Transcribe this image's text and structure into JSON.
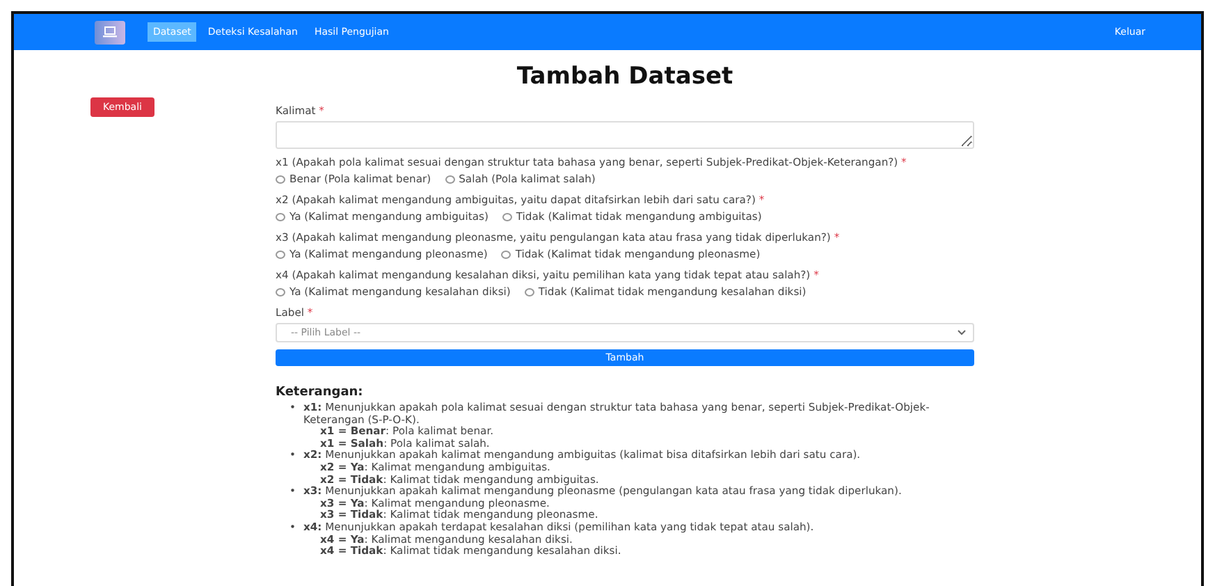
{
  "navbar": {
    "items": [
      {
        "label": "Dataset",
        "selected": true
      },
      {
        "label": "Deteksi Kesalahan",
        "selected": false
      },
      {
        "label": "Hasil Pengujian",
        "selected": false
      }
    ],
    "logout": "Keluar"
  },
  "back_button": "Kembali",
  "title": "Tambah Dataset",
  "sentence_field": {
    "label": "Kalimat",
    "mark": "*"
  },
  "questions": [
    {
      "label": "x1 (Apakah pola kalimat sesuai dengan struktur tata bahasa yang benar, seperti Subjek-Predikat-Objek-Keterangan?)",
      "mark": "*",
      "options": [
        {
          "label": "Benar (Pola kalimat benar)",
          "selected": false
        },
        {
          "label": "Salah (Pola kalimat salah)",
          "selected": false
        }
      ]
    },
    {
      "label": "x2 (Apakah kalimat mengandung ambiguitas, yaitu dapat ditafsirkan lebih dari satu cara?)",
      "mark": "*",
      "options": [
        {
          "label": "Ya (Kalimat mengandung ambiguitas)",
          "selected": false
        },
        {
          "label": "Tidak (Kalimat tidak mengandung ambiguitas)",
          "selected": false
        }
      ]
    },
    {
      "label": "x3 (Apakah kalimat mengandung pleonasme, yaitu pengulangan kata atau frasa yang tidak diperlukan?)",
      "mark": "*",
      "options": [
        {
          "label": "Ya (Kalimat mengandung pleonasme)",
          "selected": false
        },
        {
          "label": "Tidak (Kalimat tidak mengandung pleonasme)",
          "selected": false
        }
      ]
    },
    {
      "label": "x4 (Apakah kalimat mengandung kesalahan diksi, yaitu pemilihan kata yang tidak tepat atau salah?)",
      "mark": "*",
      "options": [
        {
          "label": "Ya (Kalimat mengandung kesalahan diksi)",
          "selected": false
        },
        {
          "label": "Tidak (Kalimat tidak mengandung kesalahan diksi)",
          "selected": false
        }
      ]
    }
  ],
  "label_field": {
    "label": "Label",
    "mark": "*",
    "placeholder": "-- Pilih Label --"
  },
  "submit_button": "Tambah",
  "notes": {
    "title": "Keterangan:",
    "items": [
      {
        "bullet": "•",
        "text": "**x1:** Menunjukkan apakah pola kalimat sesuai dengan struktur tata bahasa yang benar, seperti Subjek-Predikat-Objek-Keterangan (S-P-O-K).",
        "values": [
          "**x1 = Benar**: Pola kalimat benar.",
          "**x1 = Salah**: Pola kalimat salah."
        ]
      },
      {
        "bullet": "•",
        "text": "**x2:** Menunjukkan apakah kalimat mengandung ambiguitas (kalimat bisa ditafsirkan lebih dari satu cara).",
        "values": [
          "**x2 = Ya**: Kalimat mengandung ambiguitas.",
          "**x2 = Tidak**: Kalimat tidak mengandung ambiguitas."
        ]
      },
      {
        "bullet": "•",
        "text": "**x3:** Menunjukkan apakah kalimat mengandung pleonasme (pengulangan kata atau frasa yang tidak diperlukan).",
        "values": [
          "**x3 = Ya**: Kalimat mengandung pleonasme.",
          "**x3 = Tidak**: Kalimat tidak mengandung pleonasme."
        ]
      },
      {
        "bullet": "•",
        "text": "**x4:** Menunjukkan apakah terdapat kesalahan diksi (pemilihan kata yang tidak tepat atau salah).",
        "values": [
          "**x4 = Ya**: Kalimat mengandung kesalahan diksi.",
          "**x4 = Tidak**: Kalimat tidak mengandung kesalahan diksi."
        ]
      }
    ]
  }
}
